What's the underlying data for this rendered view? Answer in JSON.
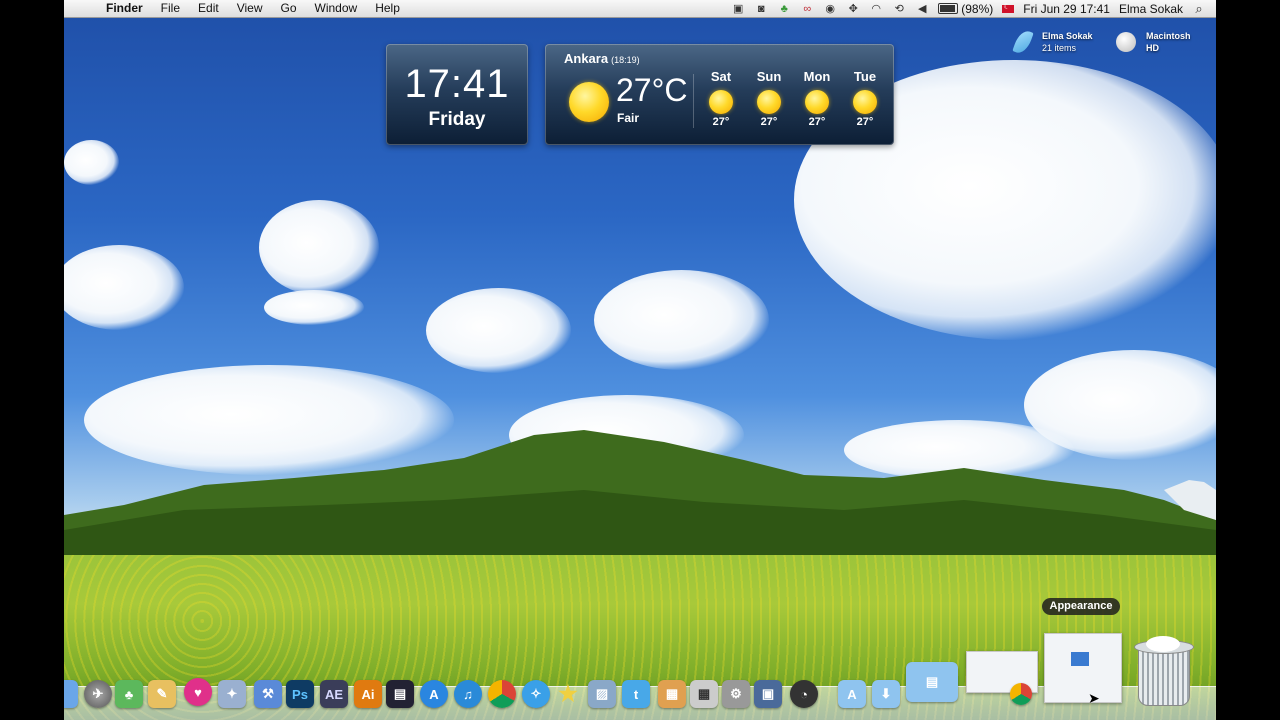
{
  "menubar": {
    "apple_glyph": "",
    "app_name": "Finder",
    "menus": [
      "File",
      "Edit",
      "View",
      "Go",
      "Window",
      "Help"
    ],
    "battery": "(98%)",
    "datetime": "Fri Jun 29  17:41",
    "user": "Elma Sokak",
    "search_glyph": "⌕"
  },
  "clock_widget": {
    "time": "17:41",
    "day": "Friday"
  },
  "weather_widget": {
    "city": "Ankara",
    "local_time": "(18:19)",
    "temperature": "27°C",
    "condition": "Fair",
    "forecast": [
      {
        "day": "Sat",
        "temp": "27°"
      },
      {
        "day": "Sun",
        "temp": "27°"
      },
      {
        "day": "Mon",
        "temp": "27°"
      },
      {
        "day": "Tue",
        "temp": "27°"
      }
    ]
  },
  "desktop_icons": [
    {
      "name": "Elma Sokak",
      "detail": "21 items"
    },
    {
      "name": "Macintosh",
      "detail": "HD"
    }
  ],
  "dock": {
    "tooltip": "Appearance",
    "labels": {
      "photoshop": "Ps",
      "after_effects": "AE",
      "illustrator": "Ai"
    }
  },
  "colors": {
    "sky": "#2b67c4",
    "widget_bg": "#253d5a",
    "sun": "#ffd92a",
    "meadow": "#9cc43a"
  }
}
